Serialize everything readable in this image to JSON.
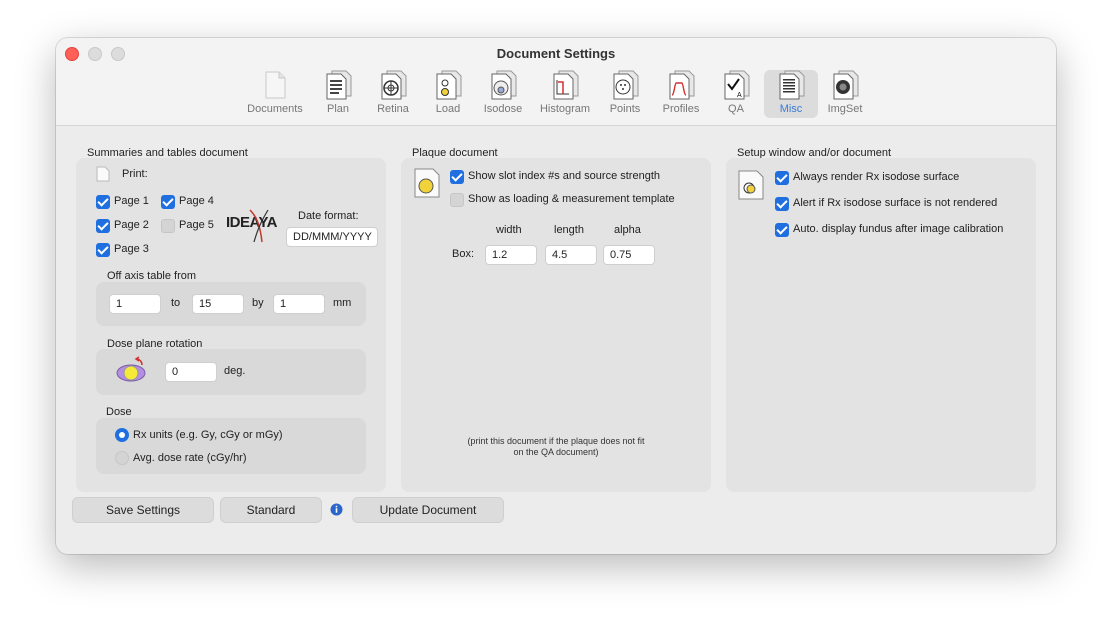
{
  "window": {
    "title": "Document Settings"
  },
  "tabs": [
    {
      "label": "Documents",
      "icon": "blank-document-icon",
      "active": false
    },
    {
      "label": "Plan",
      "icon": "plan-document-icon",
      "active": false
    },
    {
      "label": "Retina",
      "icon": "retina-document-icon",
      "active": false
    },
    {
      "label": "Load",
      "icon": "load-document-icon",
      "active": false
    },
    {
      "label": "Isodose",
      "icon": "isodose-document-icon",
      "active": false
    },
    {
      "label": "Histogram",
      "icon": "histogram-document-icon",
      "active": false
    },
    {
      "label": "Points",
      "icon": "points-document-icon",
      "active": false
    },
    {
      "label": "Profiles",
      "icon": "profiles-document-icon",
      "active": false
    },
    {
      "label": "QA",
      "icon": "qa-document-icon",
      "active": false
    },
    {
      "label": "Misc",
      "icon": "misc-document-icon",
      "active": true
    },
    {
      "label": "ImgSet",
      "icon": "imgset-document-icon",
      "active": false
    }
  ],
  "summaries": {
    "title": "Summaries and tables document",
    "print_label": "Print:",
    "pages": [
      {
        "label": "Page 1",
        "checked": true
      },
      {
        "label": "Page 4",
        "checked": true
      },
      {
        "label": "Page 2",
        "checked": true
      },
      {
        "label": "Page 5",
        "checked": false
      },
      {
        "label": "Page 3",
        "checked": true
      }
    ],
    "logo_text": "IDEAYA",
    "date_format_label": "Date format:",
    "date_format_value": "DD/MMM/YYYY",
    "off_axis": {
      "title": "Off axis table from",
      "from": "1",
      "to_label": "to",
      "to": "15",
      "by_label": "by",
      "by": "1",
      "unit": "mm"
    },
    "rotation": {
      "title": "Dose plane rotation",
      "value": "0",
      "unit": "deg."
    },
    "dose": {
      "title": "Dose",
      "options": [
        {
          "label": "Rx units (e.g. Gy, cGy or mGy)",
          "selected": true
        },
        {
          "label": "Avg. dose rate (cGy/hr)",
          "selected": false
        }
      ]
    }
  },
  "plaque": {
    "title": "Plaque document",
    "options": [
      {
        "label": "Show slot index #s and source strength",
        "checked": true
      },
      {
        "label": "Show as loading & measurement template",
        "checked": false
      }
    ],
    "box": {
      "label": "Box:",
      "headers": [
        "width",
        "length",
        "alpha"
      ],
      "values": [
        "1.2",
        "4.5",
        "0.75"
      ]
    },
    "note_line1": "(print this document if the plaque does not fit",
    "note_line2": "on the QA document)"
  },
  "setup": {
    "title": "Setup window and/or document",
    "options": [
      {
        "label": "Always render Rx isodose surface",
        "checked": true
      },
      {
        "label": "Alert if Rx isodose surface is not rendered",
        "checked": true
      },
      {
        "label": "Auto. display fundus after image calibration",
        "checked": true
      }
    ]
  },
  "buttons": {
    "save": "Save Settings",
    "standard": "Standard",
    "update": "Update Document"
  },
  "colors": {
    "accent": "#1f6fe0",
    "close": "#fe5f57"
  }
}
